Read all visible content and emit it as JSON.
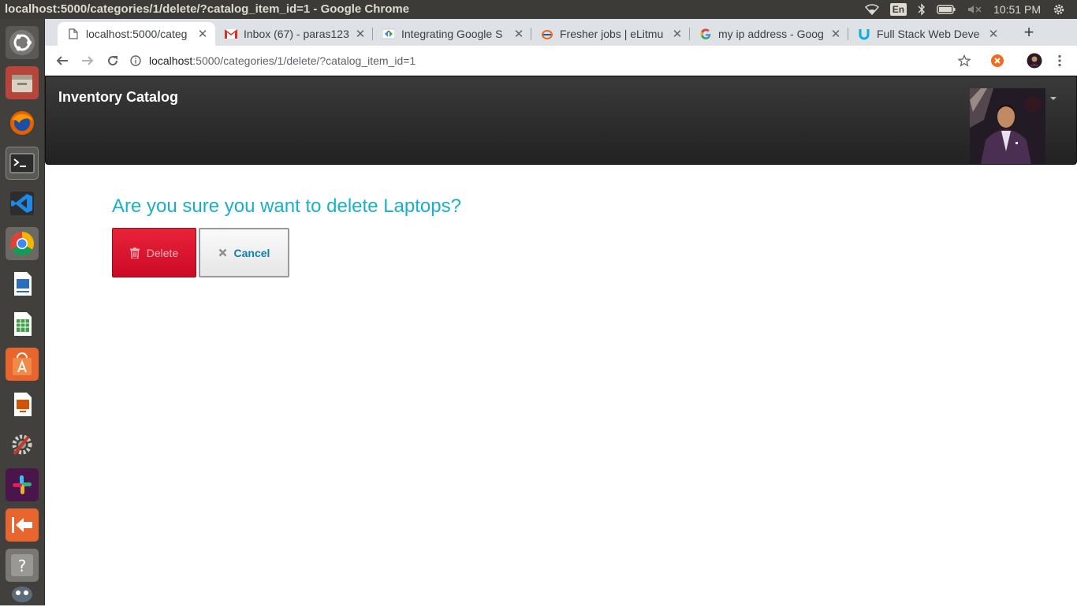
{
  "os": {
    "window_title": "localhost:5000/categories/1/delete/?catalog_item_id=1 - Google Chrome",
    "keyboard_layout": "En",
    "clock": "10:51 PM"
  },
  "launcher": {
    "apps": [
      "ubuntu-dash-icon",
      "files-icon",
      "firefox-icon",
      "terminal-icon",
      "vscode-icon",
      "chrome-icon",
      "writer-icon",
      "calc-icon",
      "software-center-icon",
      "impress-icon",
      "system-settings-icon",
      "slack-icon",
      "app-icon",
      "help-icon",
      "other-icon"
    ]
  },
  "browser": {
    "tabs": [
      {
        "title": "localhost:5000/categ",
        "icon": "page-icon",
        "active": true
      },
      {
        "title": "Inbox (67) - paras123",
        "icon": "gmail-icon"
      },
      {
        "title": "Integrating Google S",
        "icon": "google-devs-icon"
      },
      {
        "title": "Fresher jobs | eLitmu",
        "icon": "elitmus-icon"
      },
      {
        "title": "my ip address - Goog",
        "icon": "google-icon"
      },
      {
        "title": "Full Stack Web Deve",
        "icon": "udacity-icon"
      }
    ],
    "new_tab_label": "+",
    "address": {
      "host": "localhost",
      "path": ":5000/categories/1/delete/?catalog_item_id=1"
    }
  },
  "page": {
    "brand": "Inventory Catalog",
    "question": "Are you sure you want to delete Laptops?",
    "delete_label": "Delete",
    "cancel_label": "Cancel",
    "colors": {
      "question": "#1ab0c8",
      "delete_bg": "#d91530",
      "cancel_text": "#0d7fb0"
    }
  }
}
